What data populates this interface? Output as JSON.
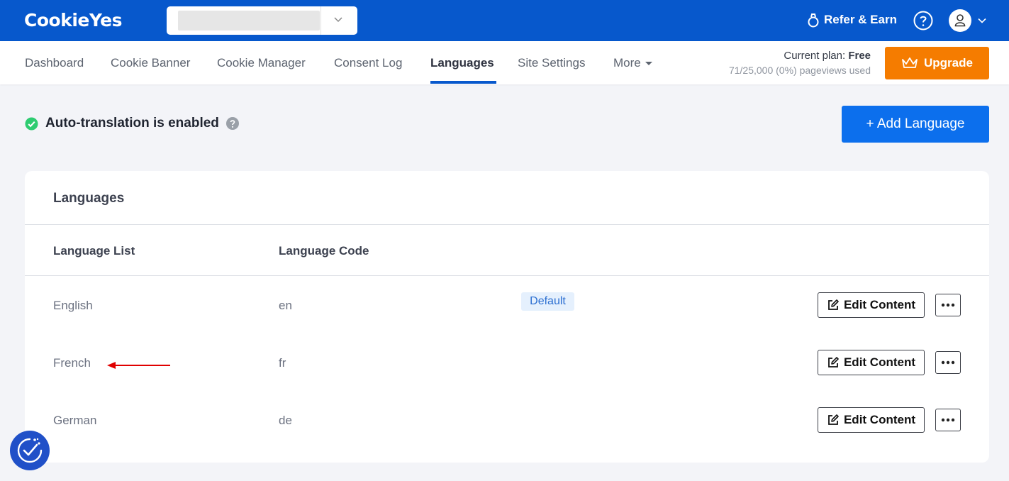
{
  "app": {
    "logo": "CookieYes"
  },
  "topbar": {
    "refer_label": "Refer & Earn"
  },
  "nav": {
    "tabs": [
      {
        "label": "Dashboard"
      },
      {
        "label": "Cookie Banner"
      },
      {
        "label": "Cookie Manager"
      },
      {
        "label": "Consent Log"
      },
      {
        "label": "Languages"
      },
      {
        "label": "Site Settings"
      },
      {
        "label": "More"
      }
    ],
    "active_tab": "Languages"
  },
  "plan": {
    "label": "Current plan:",
    "name": "Free",
    "usage": "71/25,000 (0%) pageviews used"
  },
  "upgrade": {
    "label": "Upgrade"
  },
  "auto_translation": {
    "text": "Auto-translation is enabled"
  },
  "add_language": {
    "label": "+ Add Language"
  },
  "languages": {
    "title": "Languages",
    "headers": {
      "list": "Language List",
      "code": "Language Code"
    },
    "default_badge": "Default",
    "edit_label": "Edit Content",
    "rows": [
      {
        "name": "English",
        "code": "en",
        "default": true
      },
      {
        "name": "French",
        "code": "fr",
        "default": false
      },
      {
        "name": "German",
        "code": "de",
        "default": false
      }
    ]
  },
  "colors": {
    "brand": "#0758cc",
    "upgrade": "#f57c00",
    "primary_button": "#0c6fed",
    "success": "#2ecc71",
    "annotation_arrow": "#e00000"
  },
  "icons": [
    "chevron-down-icon",
    "ring-icon",
    "help-icon",
    "user-icon",
    "crown-icon",
    "check-circle-icon",
    "question-icon",
    "edit-icon",
    "more-dots-icon",
    "consent-fab-icon"
  ]
}
